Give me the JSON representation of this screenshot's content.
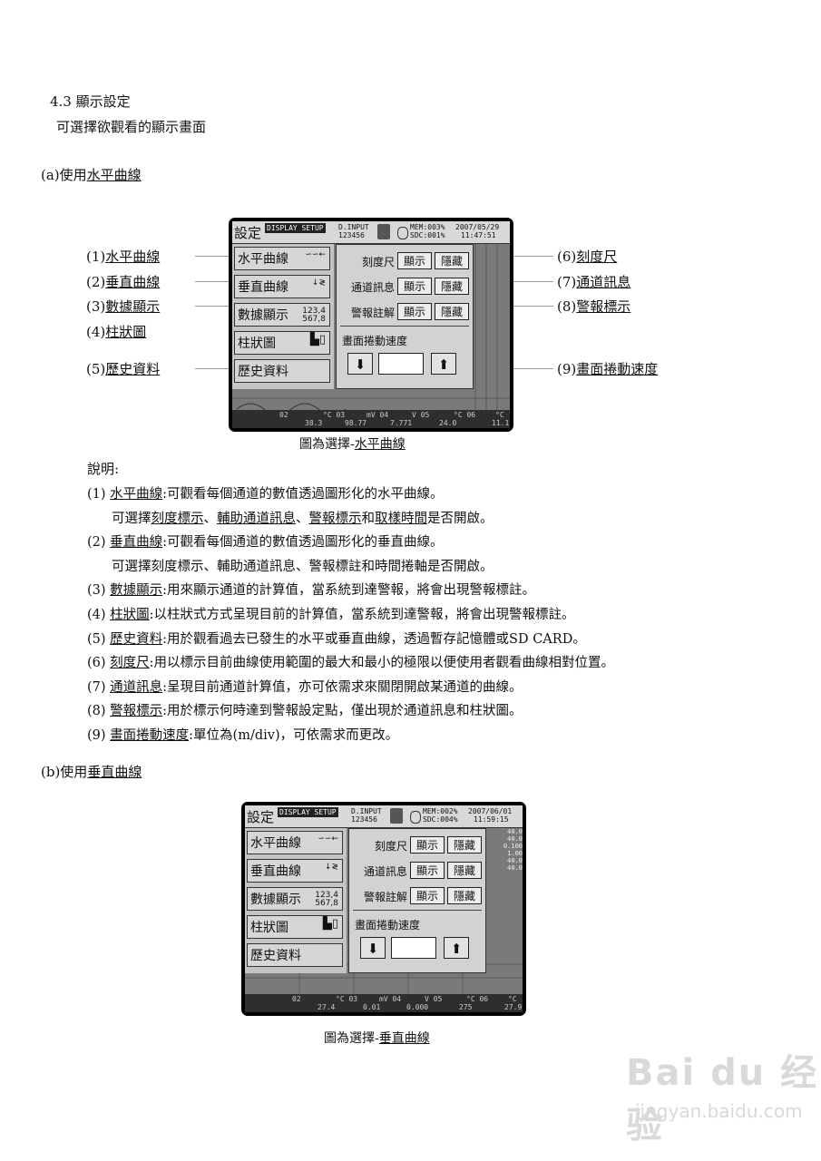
{
  "section": {
    "number": "4.3",
    "title": "顯示設定",
    "subtitle": "可選擇欲觀看的顯示畫面"
  },
  "part_a": {
    "prefix": "(a)使用",
    "name": "水平曲線"
  },
  "part_b": {
    "prefix": "(b)使用",
    "name": "垂直曲線"
  },
  "callouts_left": [
    {
      "num": "(1)",
      "text": "水平曲線"
    },
    {
      "num": "(2)",
      "text": "垂直曲線"
    },
    {
      "num": "(3)",
      "text": "數據顯示"
    },
    {
      "num": "(4)",
      "text": "柱狀圖"
    },
    {
      "num": "(5)",
      "text": "歷史資料"
    }
  ],
  "callouts_right": [
    {
      "num": "(6)",
      "text": "刻度尺"
    },
    {
      "num": "(7)",
      "text": "通道訊息"
    },
    {
      "num": "(8)",
      "text": "警報標示"
    },
    {
      "num": "(9)",
      "text": "畫面捲動速度"
    }
  ],
  "caption_a": {
    "prefix": "圖為選擇-",
    "name": "水平曲線"
  },
  "caption_b": {
    "prefix": "圖為選擇-",
    "name": "垂直曲線"
  },
  "explain_title": "說明:",
  "explanations": [
    {
      "num": "(1)",
      "term": "水平曲線",
      "text": ":可觀看每個通道的數值透過圖形化的水平曲線。"
    },
    {
      "num": "(2)",
      "term": "垂直曲線",
      "text": ":可觀看每個通道的數值透過圖形化的垂直曲線。"
    },
    {
      "num": "(3)",
      "term": "數據顯示",
      "text": ":用來顯示通道的計算值，當系統到達警報，將會出現警報標註。"
    },
    {
      "num": "(4)",
      "term": "柱狀圖",
      "text": ":以柱狀式方式呈現目前的計算值，當系統到達警報，將會出現警報標註。"
    },
    {
      "num": "(5)",
      "term": "歷史資料",
      "text": ":用於觀看過去已發生的水平或垂直曲線，透過暫存記憶體或SD CARD。"
    },
    {
      "num": "(6)",
      "term": "刻度尺",
      "text": ":用以標示目前曲線使用範圍的最大和最小的極限以便使用者觀看曲線相對位置。"
    },
    {
      "num": "(7)",
      "term": "通道訊息",
      "text": ":呈現目前通道計算值，亦可依需求來關閉開啟某通道的曲線。"
    },
    {
      "num": "(8)",
      "term": "警報標示",
      "text": ":用於標示何時達到警報設定點，僅出現於通道訊息和柱狀圖。"
    },
    {
      "num": "(9)",
      "term": "畫面捲動速度",
      "text": ":單位為(m/div)，可依需求而更改。"
    }
  ],
  "explain1_sub": {
    "pre": "可選擇",
    "a": "刻度標示",
    "sep1": "、",
    "b": "輔助通道訊息",
    "sep2": "、",
    "c": "警報標示",
    "and": "和",
    "d": "取樣時間",
    "post": "是否開啟。"
  },
  "explain2_sub": "可選擇刻度標示、輔助通道訊息、警報標註和時間捲軸是否開啟。",
  "screen": {
    "title": "設定",
    "badge": "DISPLAY SETUP",
    "dinput_1": "D.INPUT",
    "dinput_2": "123456",
    "menu": [
      "水平曲線",
      "垂直曲線",
      "數據顯示",
      "柱狀圖",
      "歷史資料"
    ],
    "menu_icon_numbers": [
      "123,4",
      "567,8"
    ],
    "rows": [
      "刻度尺",
      "通道訊息",
      "警報註解"
    ],
    "show": "顯示",
    "hide": "隱藏",
    "speed_label": "畫面捲動速度",
    "arrow_down": "⬇",
    "arrow_up": "⬆"
  },
  "screen_a": {
    "mem": "MEM:003%",
    "sdc": "SDC:001%",
    "date": "2007/05/29",
    "time": "11:47:51",
    "bottom_units": [
      "02",
      "°C 03",
      "mV 04",
      "V 05",
      "°C 06",
      "°C"
    ],
    "bottom_values": [
      "38.3",
      "98.77",
      "7.771",
      "24.0",
      "11.1"
    ]
  },
  "screen_b": {
    "mem": "MEM:002%",
    "sdc": "SDC:004%",
    "date": "2007/06/01",
    "time": "11:59:15",
    "scale_values": [
      "40.0",
      "40.0",
      "0.100",
      "1.00",
      "40.0",
      "40.0"
    ],
    "bottom_units": [
      "02",
      "°C 03",
      "mV 04",
      "V 05",
      "°C 06",
      "°C"
    ],
    "bottom_values": [
      "27.4",
      "0.01",
      "0.000",
      "275",
      "27.9"
    ]
  },
  "watermark": {
    "brand": "Bai du 经验",
    "url": "jingyan.baidu.com"
  }
}
